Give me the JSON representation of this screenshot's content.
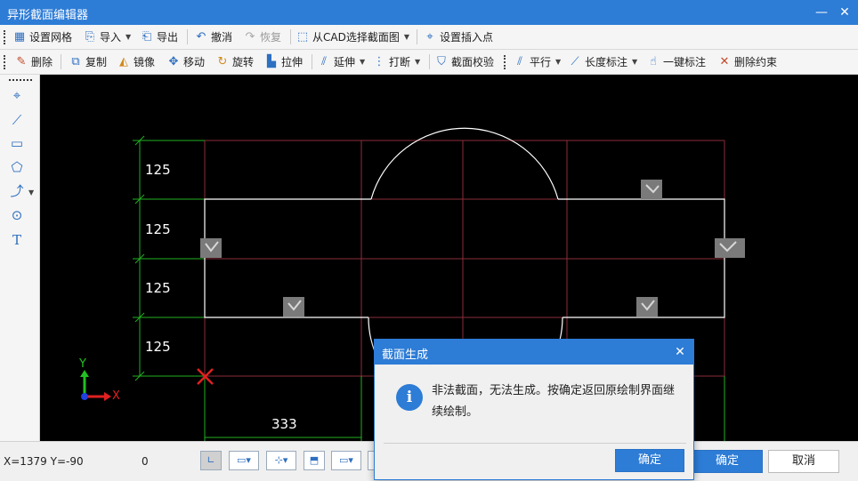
{
  "window": {
    "title": "异形截面编辑器",
    "minimize_icon": "minimize-icon",
    "close_icon": "close-icon"
  },
  "toolbar1": {
    "items": [
      {
        "label": "设置网格",
        "icon": "grid-icon"
      },
      {
        "label": "导入",
        "icon": "import-icon"
      },
      {
        "label": "导出",
        "icon": "export-icon"
      },
      {
        "label": "撤消",
        "icon": "undo-icon"
      },
      {
        "label": "恢复",
        "icon": "redo-icon"
      },
      {
        "label": "从CAD选择截面图",
        "icon": "cad-select-icon"
      },
      {
        "label": "设置插入点",
        "icon": "insert-point-icon"
      }
    ]
  },
  "toolbar2": {
    "items": [
      {
        "label": "删除",
        "icon": "delete-icon"
      },
      {
        "label": "复制",
        "icon": "copy-icon"
      },
      {
        "label": "镜像",
        "icon": "mirror-icon"
      },
      {
        "label": "移动",
        "icon": "move-icon"
      },
      {
        "label": "旋转",
        "icon": "rotate-icon"
      },
      {
        "label": "拉伸",
        "icon": "stretch-icon"
      },
      {
        "label": "延伸",
        "icon": "extend-icon"
      },
      {
        "label": "打断",
        "icon": "break-icon"
      },
      {
        "label": "截面校验",
        "icon": "shield-check-icon"
      },
      {
        "label": "平行",
        "icon": "parallel-icon"
      },
      {
        "label": "长度标注",
        "icon": "length-dimension-icon"
      },
      {
        "label": "一键标注",
        "icon": "auto-dimension-icon"
      },
      {
        "label": "删除约束",
        "icon": "delete-constraint-icon"
      }
    ]
  },
  "left_tools": [
    "point-icon",
    "line-icon",
    "rectangle-icon",
    "polygon-icon",
    "polyline-icon",
    "circle-icon",
    "text-icon"
  ],
  "canvas": {
    "dimensions_vertical": [
      "125",
      "125",
      "125",
      "125"
    ],
    "dimension_horizontal": "333",
    "axis_y_label": "Y",
    "axis_x_label": "X",
    "colors": {
      "grid": "#8b2e3a",
      "dimension": "#22b022",
      "shape": "#ffffff",
      "origin_marker": "#e02020",
      "background": "#000000"
    }
  },
  "statusbar": {
    "coords": "X=1379 Y=-90",
    "value": "0",
    "confirm_label": "确定",
    "cancel_label": "取消"
  },
  "dialog": {
    "title": "截面生成",
    "message": "非法截面，无法生成。按确定返回原绘制界面继续绘制。",
    "ok_label": "确定",
    "icon": "info-icon"
  }
}
